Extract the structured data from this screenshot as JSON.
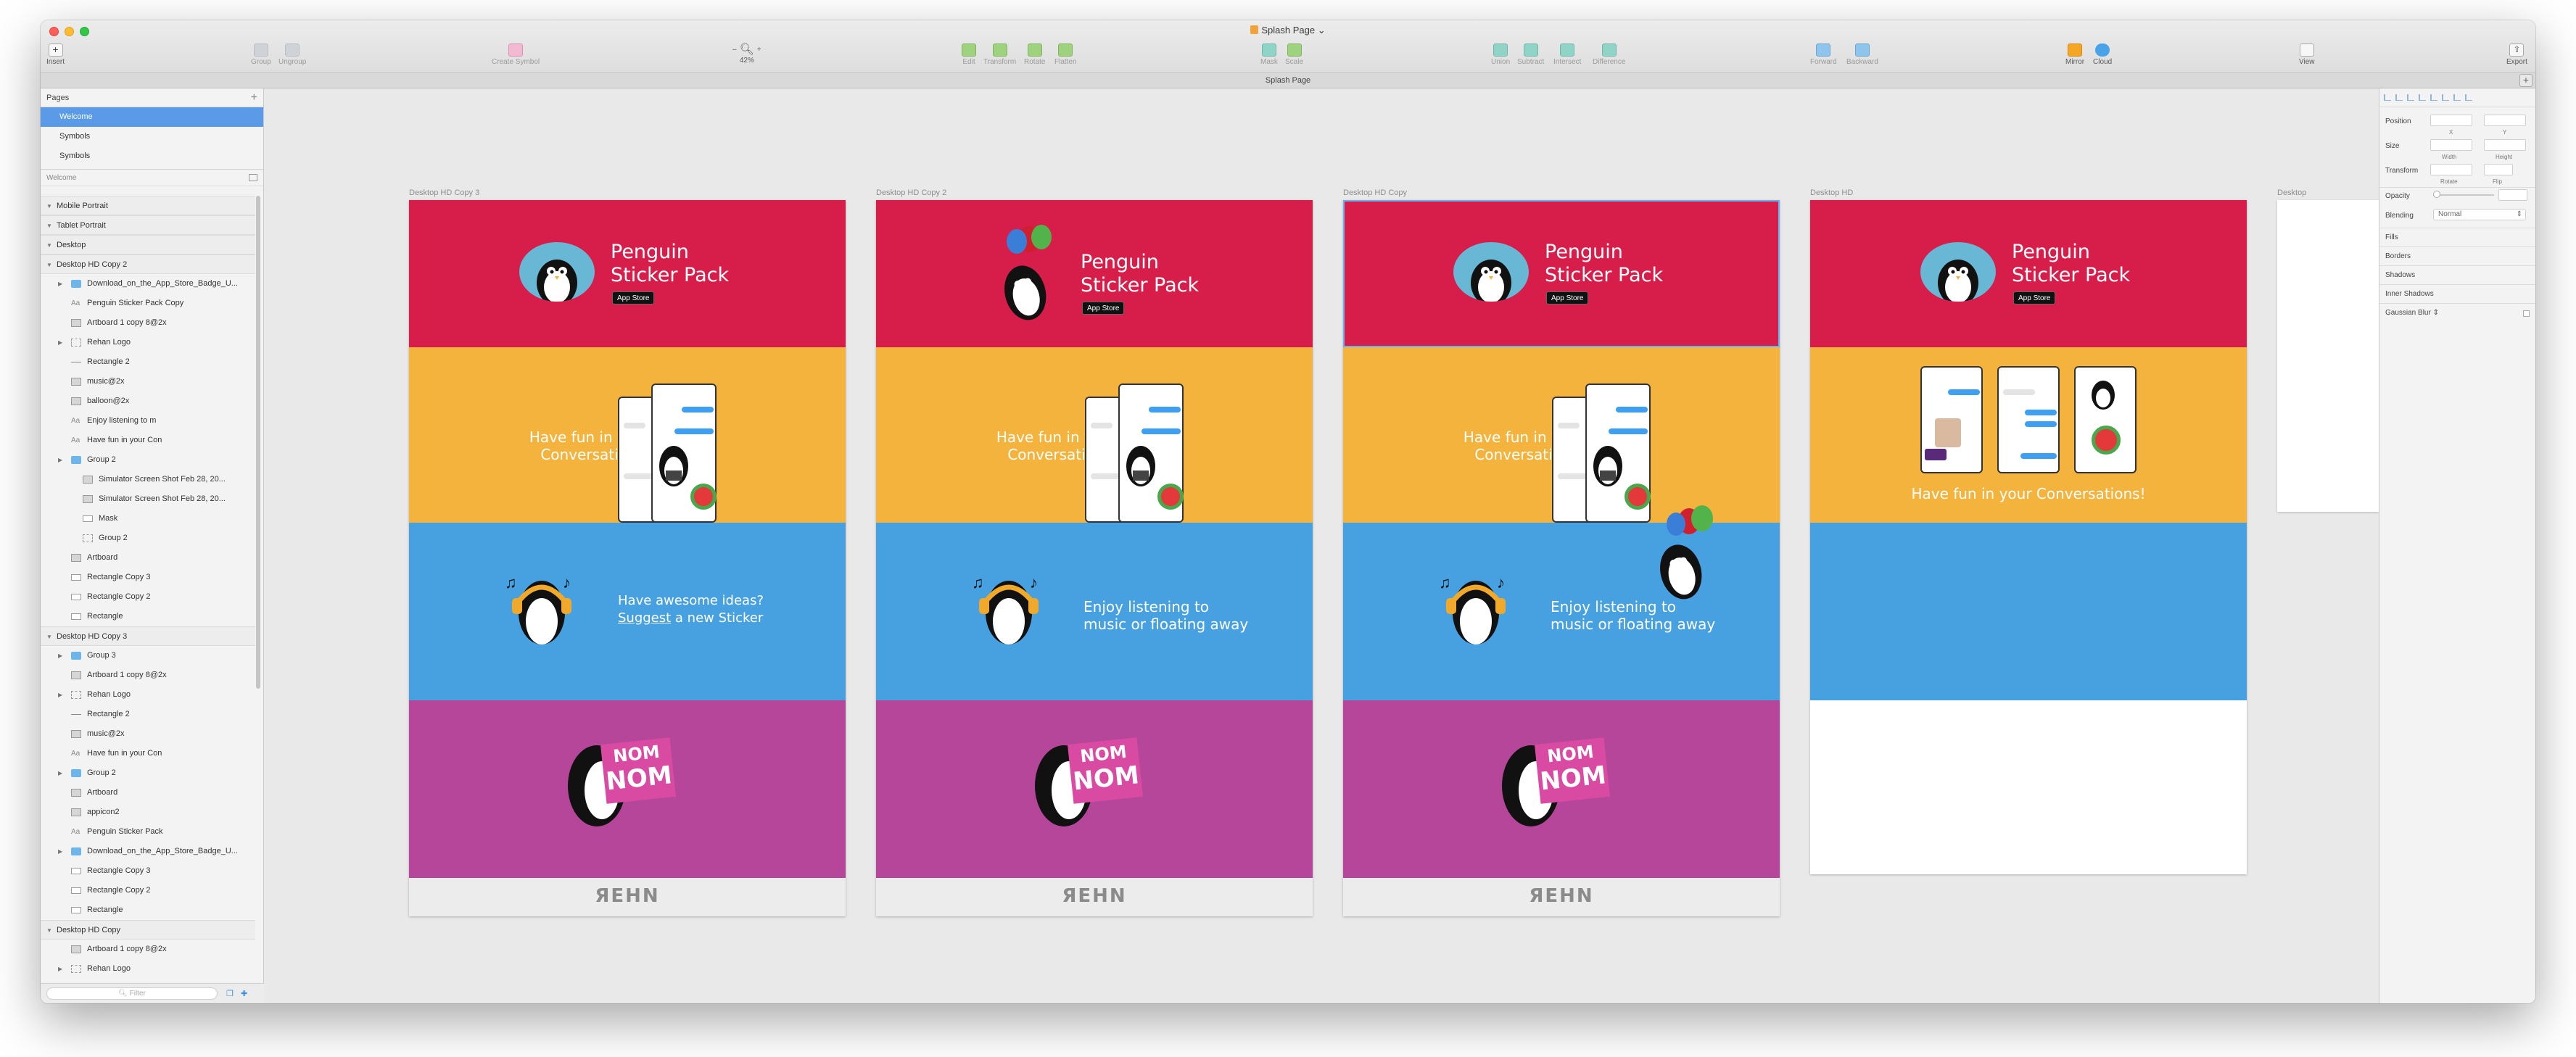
{
  "window": {
    "title": "Splash Page",
    "tab": "Splash Page"
  },
  "toolbar": {
    "insert": "Insert",
    "group": "Group",
    "ungroup": "Ungroup",
    "create_symbol": "Create Symbol",
    "zoom_minus": "–",
    "zoom_plus": "+",
    "zoom_value": "42%",
    "edit": "Edit",
    "transform": "Transform",
    "rotate": "Rotate",
    "flatten": "Flatten",
    "mask": "Mask",
    "scale": "Scale",
    "union": "Union",
    "subtract": "Subtract",
    "intersect": "Intersect",
    "difference": "Difference",
    "forward": "Forward",
    "backward": "Backward",
    "mirror": "Mirror",
    "cloud": "Cloud",
    "view": "View",
    "export": "Export"
  },
  "pages": {
    "header": "Pages",
    "add": "+",
    "items": [
      "Welcome",
      "Symbols",
      "Symbols"
    ],
    "selected": 0
  },
  "layers": {
    "header": "Welcome",
    "items": [
      {
        "name": "Mobile Portrait",
        "type": "artboard",
        "indent": 0
      },
      {
        "name": "Tablet Portrait",
        "type": "artboard",
        "indent": 0
      },
      {
        "name": "Desktop",
        "type": "artboard",
        "indent": 0
      },
      {
        "name": "Desktop HD Copy 2",
        "type": "artboard",
        "indent": 0
      },
      {
        "name": "Download_on_the_App_Store_Badge_U...",
        "type": "folder",
        "indent": 1
      },
      {
        "name": "Penguin Sticker Pack Copy",
        "type": "text",
        "indent": 1
      },
      {
        "name": "Artboard 1 copy 8@2x",
        "type": "img",
        "indent": 1
      },
      {
        "name": "Rehan Logo",
        "type": "grp",
        "indent": 1
      },
      {
        "name": "Rectangle 2",
        "type": "line",
        "indent": 1
      },
      {
        "name": "music@2x",
        "type": "img",
        "indent": 1
      },
      {
        "name": "balloon@2x",
        "type": "img",
        "indent": 1
      },
      {
        "name": "Enjoy listening to m",
        "type": "text",
        "indent": 1
      },
      {
        "name": "Have fun in your Con",
        "type": "text",
        "indent": 1
      },
      {
        "name": "Group 2",
        "type": "folder",
        "indent": 1
      },
      {
        "name": "Simulator Screen Shot Feb 28, 20...",
        "type": "img",
        "indent": 2
      },
      {
        "name": "Simulator Screen Shot Feb 28, 20...",
        "type": "img",
        "indent": 2
      },
      {
        "name": "Mask",
        "type": "rect",
        "indent": 2
      },
      {
        "name": "Group 2",
        "type": "grp",
        "indent": 2
      },
      {
        "name": "Artboard",
        "type": "img",
        "indent": 1
      },
      {
        "name": "Rectangle Copy 3",
        "type": "rect",
        "indent": 1
      },
      {
        "name": "Rectangle Copy 2",
        "type": "rect",
        "indent": 1
      },
      {
        "name": "Rectangle",
        "type": "rect",
        "indent": 1
      },
      {
        "name": "Desktop HD Copy 3",
        "type": "artboard",
        "indent": 0
      },
      {
        "name": "Group 3",
        "type": "folder",
        "indent": 1
      },
      {
        "name": "Artboard 1 copy 8@2x",
        "type": "img",
        "indent": 1
      },
      {
        "name": "Rehan Logo",
        "type": "grp",
        "indent": 1
      },
      {
        "name": "Rectangle 2",
        "type": "line",
        "indent": 1
      },
      {
        "name": "music@2x",
        "type": "img",
        "indent": 1
      },
      {
        "name": "Have fun in your Con",
        "type": "text",
        "indent": 1
      },
      {
        "name": "Group 2",
        "type": "folder",
        "indent": 1
      },
      {
        "name": "Artboard",
        "type": "img",
        "indent": 1
      },
      {
        "name": "appicon2",
        "type": "img",
        "indent": 1
      },
      {
        "name": "Penguin Sticker Pack",
        "type": "text",
        "indent": 1
      },
      {
        "name": "Download_on_the_App_Store_Badge_U...",
        "type": "folder",
        "indent": 1
      },
      {
        "name": "Rectangle Copy 3",
        "type": "rect",
        "indent": 1
      },
      {
        "name": "Rectangle Copy 2",
        "type": "rect",
        "indent": 1
      },
      {
        "name": "Rectangle",
        "type": "rect",
        "indent": 1
      },
      {
        "name": "Desktop HD Copy",
        "type": "artboard",
        "indent": 0
      },
      {
        "name": "Artboard 1 copy 8@2x",
        "type": "img",
        "indent": 1
      },
      {
        "name": "Rehan Logo",
        "type": "grp",
        "indent": 1
      }
    ],
    "filter_placeholder": "Filter"
  },
  "inspector": {
    "position": "Position",
    "x": "X",
    "y": "Y",
    "size": "Size",
    "width": "Width",
    "height": "Height",
    "transform": "Transform",
    "rotate": "Rotate",
    "flip": "Flip",
    "opacity": "Opacity",
    "blending": "Blending",
    "blending_value": "Normal",
    "fills": "Fills",
    "borders": "Borders",
    "shadows": "Shadows",
    "inner_shadows": "Inner Shadows",
    "gaussian_blur": "Gaussian Blur"
  },
  "artboards": {
    "labels": [
      "Desktop HD Copy 3",
      "Desktop HD Copy 2",
      "Desktop HD Copy",
      "Desktop HD",
      "Desktop"
    ],
    "title_line1": "Penguin",
    "title_line2": "Sticker Pack",
    "app_store": "App Store",
    "have_fun": "Have fun in your\nConversations!",
    "have_fun_line1": "Have fun in your",
    "have_fun_line2": "Conversations!",
    "have_fun_single": "Have fun in your Conversations!",
    "ideas_line1": "Have awesome ideas?",
    "ideas_link": "Suggest",
    "ideas_rest": " a new Sticker",
    "enjoy_line1": "Enjoy listening to",
    "enjoy_line2": "music or floating away",
    "nom": "NOM",
    "logo": "ЯEHN"
  },
  "colors": {
    "red": "#d71d49",
    "yellow": "#f4b33d",
    "blue": "#47a0df",
    "purple": "#b5469a",
    "selection": "#5a9ae6"
  }
}
